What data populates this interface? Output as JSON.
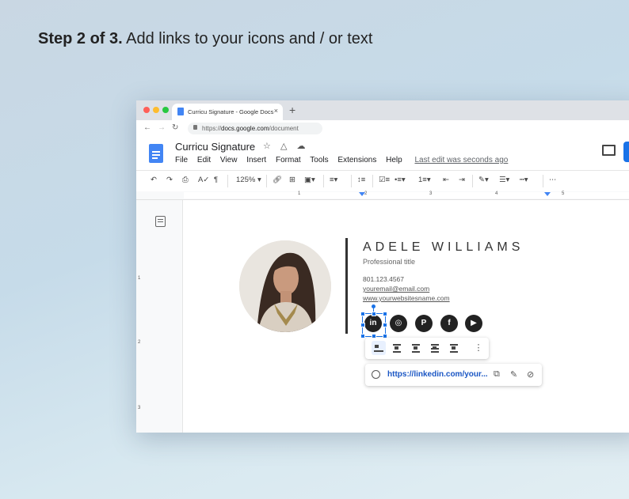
{
  "instruction": {
    "step": "Step 2 of 3.",
    "text": "Add links to your icons and / or text"
  },
  "browser": {
    "tab_title": "Curricu Signature - Google Docs",
    "tab_close": "×",
    "new_tab": "+",
    "url_prefix": "https://",
    "url_host": "docs.google.com",
    "url_path": "/document"
  },
  "docs": {
    "title": "Curricu Signature",
    "menu": [
      "File",
      "Edit",
      "View",
      "Insert",
      "Format",
      "Tools",
      "Extensions",
      "Help"
    ],
    "last_edit": "Last edit was seconds ago"
  },
  "toolbar": {
    "zoom": "125%",
    "more": "⋯"
  },
  "ruler": {
    "h": [
      "1",
      "2",
      "3",
      "4",
      "5"
    ],
    "v": [
      "1",
      "2",
      "3"
    ]
  },
  "signature": {
    "name": "ADELE WILLIAMS",
    "title": "Professional title",
    "phone": "801.123.4567",
    "email": "youremail@email.com",
    "website": "www.yourwebsitesname.com",
    "social": [
      {
        "icon": "linkedin-icon",
        "glyph": "in"
      },
      {
        "icon": "instagram-icon",
        "glyph": "◎"
      },
      {
        "icon": "pinterest-icon",
        "glyph": "P"
      },
      {
        "icon": "facebook-icon",
        "glyph": "f"
      },
      {
        "icon": "youtube-icon",
        "glyph": "▶"
      }
    ]
  },
  "link_popup": {
    "url": "https://linkedin.com/your..."
  },
  "colors": {
    "accent": "#1a73e8",
    "docs_blue": "#4285f4",
    "link": "#1a56c4"
  }
}
